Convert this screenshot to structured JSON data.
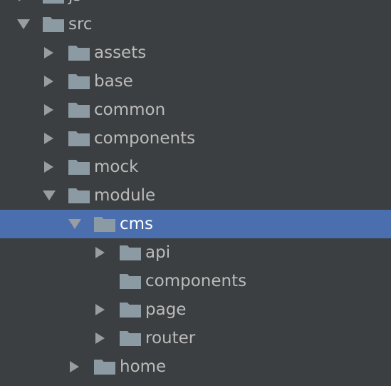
{
  "colors": {
    "background": "#3c3f41",
    "selection": "#4b6eaf",
    "text": "#bbbbbb",
    "text_selected": "#ffffff",
    "arrow": "#9a9da0",
    "folder": "#8c9aa3"
  },
  "tree": [
    {
      "label": "js",
      "depth": 0,
      "expander": "collapsed",
      "icon": "folder-icon"
    },
    {
      "label": "src",
      "depth": 0,
      "expander": "expanded",
      "icon": "folder-icon"
    },
    {
      "label": "assets",
      "depth": 1,
      "expander": "collapsed",
      "icon": "folder-icon"
    },
    {
      "label": "base",
      "depth": 1,
      "expander": "collapsed",
      "icon": "folder-icon"
    },
    {
      "label": "common",
      "depth": 1,
      "expander": "collapsed",
      "icon": "folder-icon"
    },
    {
      "label": "components",
      "depth": 1,
      "expander": "collapsed",
      "icon": "folder-icon"
    },
    {
      "label": "mock",
      "depth": 1,
      "expander": "collapsed",
      "icon": "folder-icon"
    },
    {
      "label": "module",
      "depth": 1,
      "expander": "expanded",
      "icon": "folder-icon"
    },
    {
      "label": "cms",
      "depth": 2,
      "expander": "expanded",
      "icon": "folder-icon",
      "selected": true
    },
    {
      "label": "api",
      "depth": 3,
      "expander": "collapsed",
      "icon": "folder-icon"
    },
    {
      "label": "components",
      "depth": 3,
      "expander": "none",
      "icon": "folder-icon"
    },
    {
      "label": "page",
      "depth": 3,
      "expander": "collapsed",
      "icon": "folder-icon"
    },
    {
      "label": "router",
      "depth": 3,
      "expander": "collapsed",
      "icon": "folder-icon"
    },
    {
      "label": "home",
      "depth": 2,
      "expander": "collapsed",
      "icon": "folder-icon"
    }
  ]
}
